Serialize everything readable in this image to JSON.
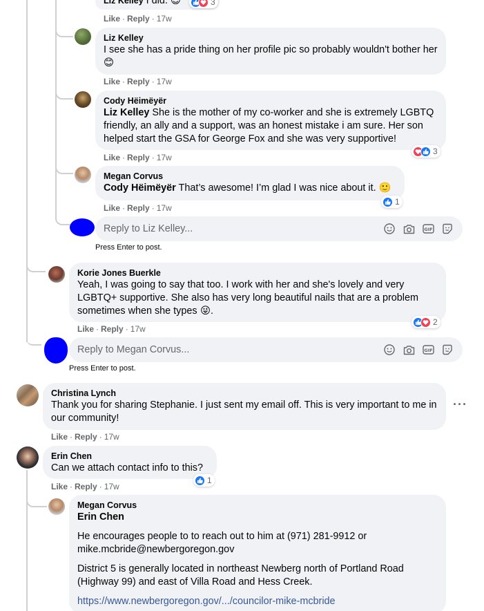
{
  "comments": {
    "liz_top": {
      "author": "Liz Kelley",
      "text": "I did.",
      "reaction_count": "3",
      "like": "Like",
      "reply": "Reply",
      "time": "17w"
    },
    "liz_pride": {
      "author": "Liz Kelley",
      "text": "I see she has a pride thing on her profile pic so probably wouldn't bother her",
      "like": "Like",
      "reply": "Reply",
      "time": "17w"
    },
    "cody": {
      "author": "Cody Hëimëyër",
      "mention": "Liz Kelley",
      "text": "She is the mother of my co-worker and she is extremely LGBTQ friendly, an ally and a support, was an honest mistake i am sure. Her son helped start the GSA for George Fox and she was very supportive!",
      "reaction_count": "3",
      "like": "Like",
      "reply": "Reply",
      "time": "17w"
    },
    "megan1": {
      "author": "Megan Corvus",
      "mention": "Cody Hëimëyër",
      "text": "That’s awesome! I’m glad I was nice about it.",
      "reaction_count": "1",
      "like": "Like",
      "reply": "Reply",
      "time": "17w"
    },
    "korie": {
      "author": "Korie Jones Buerkle",
      "text": "Yeah, I was going to say that too. I work with her and she's lovely and very LGBTQ+ supportive. She also has very long beautiful nails that are a problem sometimes when she types",
      "reaction_count": "2",
      "like": "Like",
      "reply": "Reply",
      "time": "17w"
    },
    "christina": {
      "author": "Christina Lynch",
      "text": "Thank you for sharing Stephanie. I just sent my email off. This is very important to me in our community!",
      "like": "Like",
      "reply": "Reply",
      "time": "17w"
    },
    "erin": {
      "author": "Erin Chen",
      "text": "Can we attach contact info to this?",
      "reaction_count": "1",
      "like": "Like",
      "reply": "Reply",
      "time": "17w"
    },
    "megan2": {
      "author": "Megan Corvus",
      "mention": "Erin Chen",
      "para1": "He encourages people to to reach out to him at (971) 281-9912 or mike.mcbride@newbergoregon.gov",
      "para2": "District 5 is generally located in northeast Newberg north of Portland Road (Highway 99) and east of Villa Road and Hess Creek.",
      "link": "https://www.newbergoregon.gov/.../councilor-mike-mcbride"
    }
  },
  "reply_boxes": {
    "liz": {
      "placeholder": "Reply to Liz Kelley...",
      "hint": "Press Enter to post."
    },
    "megan": {
      "placeholder": "Reply to Megan Corvus...",
      "hint": "Press Enter to post."
    }
  },
  "icons": [
    "emoji-icon",
    "camera-icon",
    "gif-icon",
    "sticker-icon",
    "more-options-icon"
  ],
  "colors": {
    "bubble": "#f0f2f5",
    "like": "#1877f2",
    "love": "#f33e58",
    "link": "#385898",
    "muted": "#65676b"
  }
}
